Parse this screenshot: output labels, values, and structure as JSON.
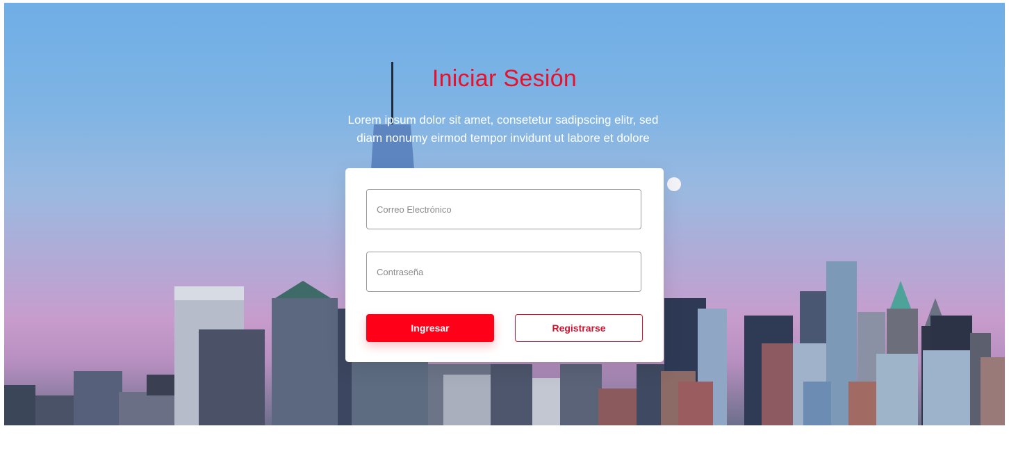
{
  "page": {
    "title": "Iniciar Sesión",
    "subtitle_line1": "Lorem ipsum dolor sit amet, consetetur sadipscing elitr, sed",
    "subtitle_line2": "diam nonumy eirmod tempor invidunt ut labore et dolore"
  },
  "form": {
    "email_placeholder": "Correo Electrónico",
    "password_placeholder": "Contraseña",
    "login_label": "Ingresar",
    "register_label": "Registrarse"
  },
  "colors": {
    "accent": "#ff0019",
    "title": "#e8102a"
  }
}
